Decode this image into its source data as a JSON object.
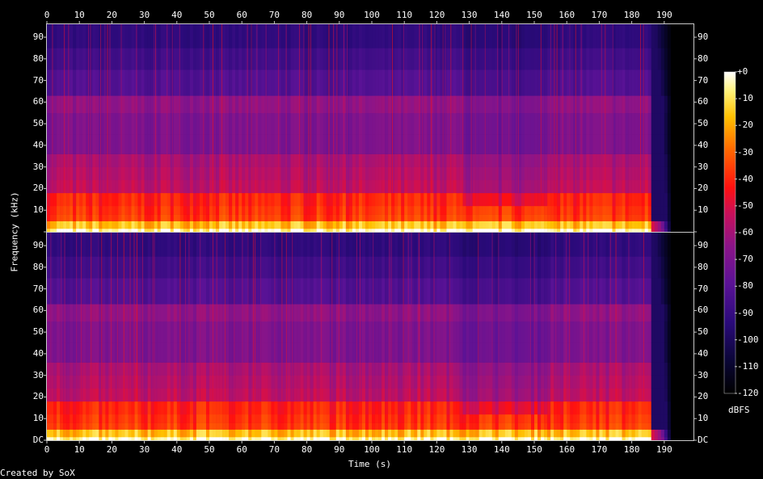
{
  "chart_data": {
    "type": "heatmap",
    "subtype": "spectrogram",
    "channels": 2,
    "xlabel": "Time (s)",
    "ylabel": "Frequency (kHz)",
    "x_ticks": [
      0,
      10,
      20,
      30,
      40,
      50,
      60,
      70,
      80,
      90,
      100,
      110,
      120,
      130,
      140,
      150,
      160,
      170,
      180,
      190
    ],
    "xlim": [
      0,
      199
    ],
    "y_ticks": [
      "DC",
      "10",
      "20",
      "30",
      "40",
      "50",
      "60",
      "70",
      "80",
      "90"
    ],
    "y_tick_values": [
      0,
      10,
      20,
      30,
      40,
      50,
      60,
      70,
      80,
      90
    ],
    "ylim": [
      0,
      96
    ],
    "colorbar": {
      "label": "dBFS",
      "ticks": [
        "+0",
        "-10",
        "-20",
        "-30",
        "-40",
        "-50",
        "-60",
        "-70",
        "-80",
        "-90",
        "-100",
        "-110",
        "-120"
      ],
      "range": [
        -120,
        0
      ]
    },
    "features": {
      "audio_end_s": 186,
      "quiet_section_s": [
        128,
        154
      ],
      "bright_band_top_khz": 18,
      "mid_band_top_khz": 36,
      "upper_band_khz": [
        55,
        63
      ]
    }
  },
  "footer": "Created by SoX",
  "colors": {
    "background": "#000000",
    "axis": "#c8c8c8",
    "text": "#ffffff"
  }
}
